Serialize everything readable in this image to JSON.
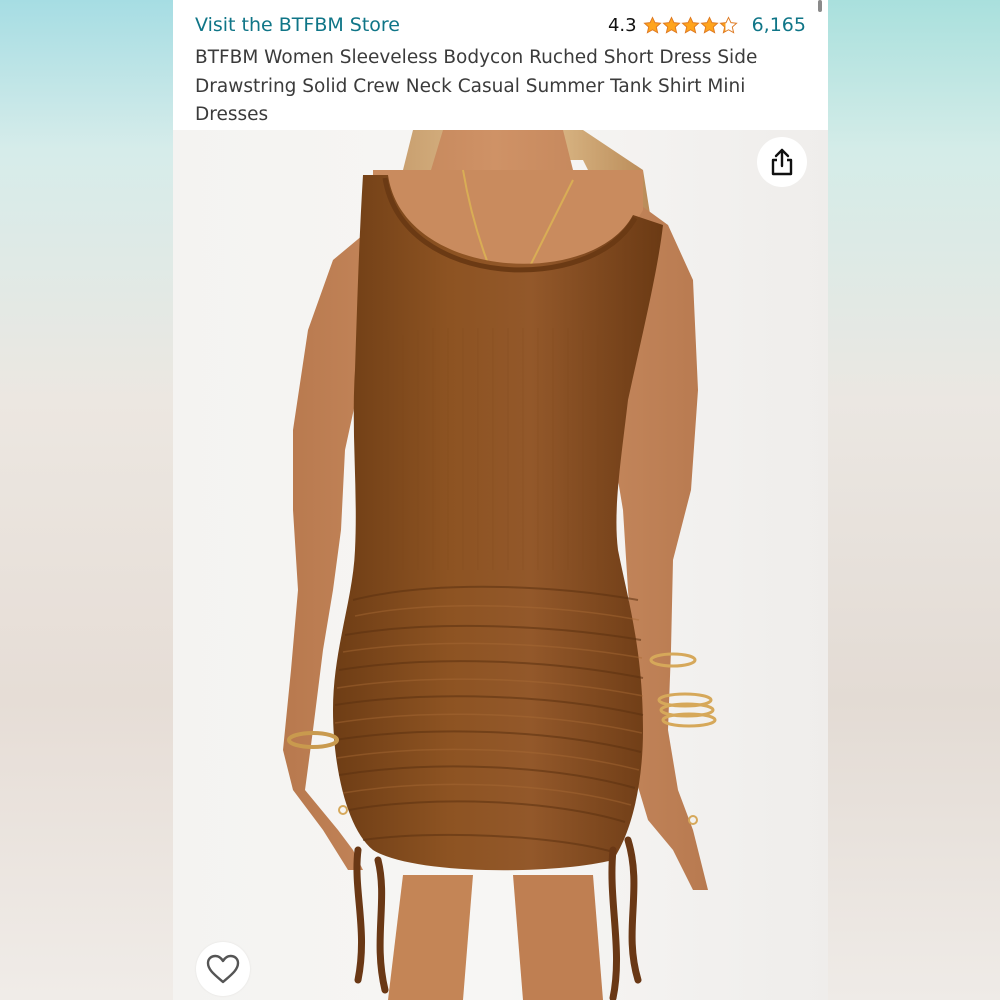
{
  "store": {
    "link_label": "Visit the BTFBM Store"
  },
  "rating": {
    "value": "4.3",
    "stars_out_of_5": 4.3,
    "review_count": "6,165"
  },
  "product": {
    "title": "BTFBM Women Sleeveless Bodycon Ruched Short Dress Side Drawstring Solid Crew Neck Casual Summer Tank Shirt Mini Dresses"
  },
  "icons": {
    "share": "share-icon",
    "wishlist": "heart-icon",
    "star": "star-icon"
  },
  "colors": {
    "link": "#0f7587",
    "star": "#ffa41c",
    "dress": "#8a4f1f",
    "background": "#ffffff"
  }
}
